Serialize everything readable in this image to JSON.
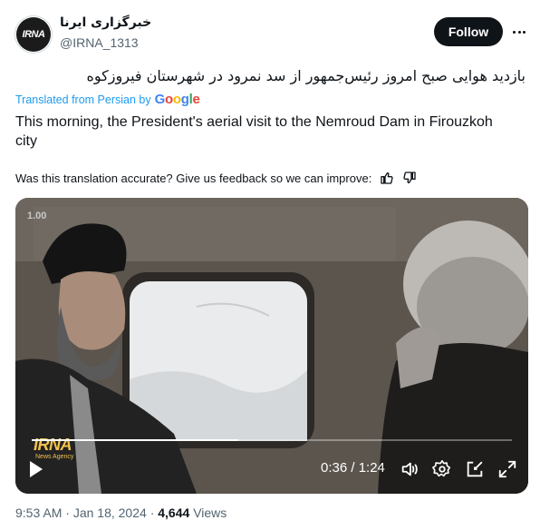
{
  "account": {
    "avatar_text": "IRNA",
    "display_name": "خبرگزاری ایرنا",
    "handle": "@IRNA_1313"
  },
  "actions": {
    "follow_label": "Follow",
    "more_icon": "more-horizontal-icon"
  },
  "post": {
    "original_text": "بازدید هوایی صبح امروز رئیس‌جمهور از سد نمرود در شهرستان فیروزکوه",
    "translated_from_label": "Translated from Persian by",
    "translation_provider": "Google",
    "translated_text": "This morning, the President's aerial visit to the Nemroud Dam in Firouzkoh city",
    "feedback_prompt": "Was this translation accurate? Give us feedback so we can improve:"
  },
  "video": {
    "speed_badge": "1.00",
    "watermark": "IRNA",
    "watermark_sub": "News Agency",
    "time_display": "0:36 / 1:24",
    "progress": 0.43
  },
  "meta": {
    "time": "9:53 AM",
    "separator": "·",
    "date": "Jan 18, 2024",
    "views_count": "4,644",
    "views_label": "Views"
  },
  "colors": {
    "accent": "#1d9bf0",
    "text": "#0f1419",
    "secondary": "#536471"
  }
}
